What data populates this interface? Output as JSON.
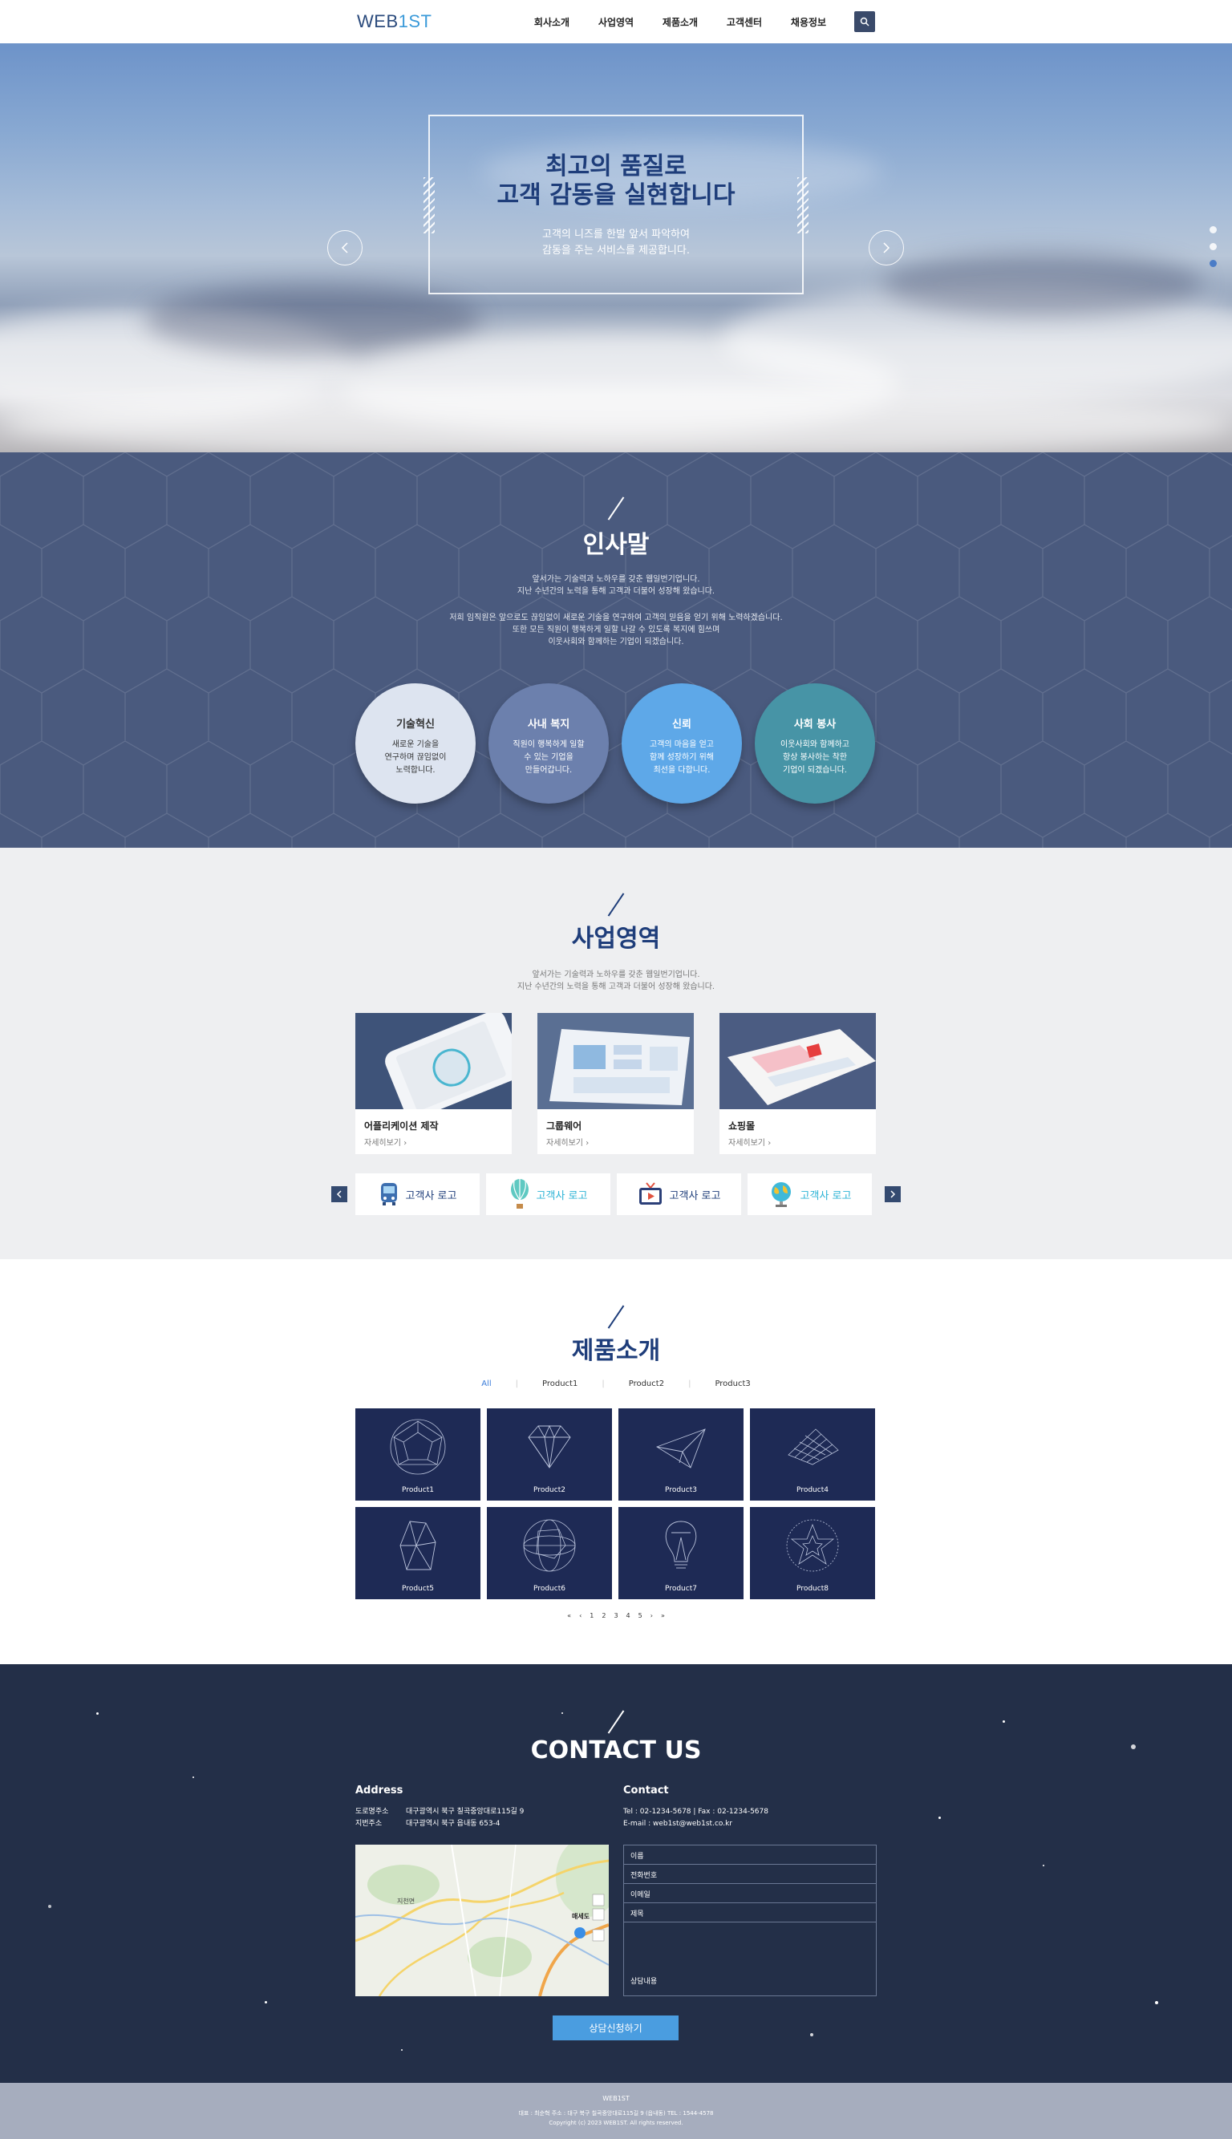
{
  "header": {
    "logo_main": "WEB",
    "logo_accent": "1ST",
    "nav": [
      "회사소개",
      "사업영역",
      "제품소개",
      "고객센터",
      "채용정보"
    ]
  },
  "hero": {
    "title_line1": "최고의 품질로",
    "title_line2": "고객 감동을 실현합니다",
    "sub_line1": "고객의 니즈를 한발 앞서 파악하여",
    "sub_line2": "감동을 주는 서비스를 제공합니다."
  },
  "greeting": {
    "title": "인사말",
    "p1_line1": "앞서가는 기술력과 노하우를 갖춘 웹일번기업니다.",
    "p1_line2": "지난 수년간의 노력을 통해 고객과 더불어 성장해 왔습니다.",
    "p2_line1": "저희 임직원은 앞으로도 끊임없이 새로운 기술을 연구하여 고객의 믿음을 얻기 위해 노력하겠습니다.",
    "p2_line2": "또한 모든 직원이 행복하게 일할 나갈 수 있도록 복지에 힘쓰며",
    "p2_line3": "이웃사회와 함께하는 기업이 되겠습니다.",
    "circles": [
      {
        "title": "기술혁신",
        "l1": "새로운 기술을",
        "l2": "연구하며 끊임없이",
        "l3": "노력합니다.",
        "bg": "#dde4f0",
        "fg": "#333"
      },
      {
        "title": "사내 복지",
        "l1": "직원이 행복하게 일할",
        "l2": "수 있는 기업을",
        "l3": "만들어갑니다.",
        "bg": "#6c80ad",
        "fg": "#fff"
      },
      {
        "title": "신뢰",
        "l1": "고객의 마음을 얻고",
        "l2": "함께 성장하기 위해",
        "l3": "최선을 다합니다.",
        "bg": "#5ea8e8",
        "fg": "#fff"
      },
      {
        "title": "사회 봉사",
        "l1": "이웃사회와 함께하고",
        "l2": "항상 봉사하는 착한",
        "l3": "기업이 되겠습니다.",
        "bg": "#4794a6",
        "fg": "#fff"
      }
    ]
  },
  "business": {
    "title": "사업영역",
    "sub_line1": "앞서가는 기술력과 노하우를 갖춘 웹일번기업니다.",
    "sub_line2": "지난 수년간의 노력을 통해 고객과 더불어 성장해 왔습니다.",
    "cards": [
      {
        "title": "어플리케이션 제작",
        "more": "자세히보기"
      },
      {
        "title": "그룹웨어",
        "more": "자세히보기"
      },
      {
        "title": "쇼핑몰",
        "more": "자세히보기"
      }
    ],
    "client_logos": [
      "고객사 로고",
      "고객사 로고",
      "고객사 로고",
      "고객사 로고"
    ]
  },
  "products": {
    "title": "제품소개",
    "tabs": [
      "All",
      "Product1",
      "Product2",
      "Product3"
    ],
    "items": [
      "Product1",
      "Product2",
      "Product3",
      "Product4",
      "Product5",
      "Product6",
      "Product7",
      "Product8"
    ],
    "pager": [
      "1",
      "2",
      "3",
      "4",
      "5"
    ]
  },
  "contact": {
    "title": "CONTACT US",
    "address_heading": "Address",
    "road_label": "도로명주소",
    "road_value": "대구광역시 북구 칠곡중앙대로115길 9",
    "lot_label": "지번주소",
    "lot_value": "대구광역시 북구 읍내동 653-4",
    "contact_heading": "Contact",
    "tel": "Tel : 02-1234-5678  |  Fax : 02-1234-5678",
    "email": "E-mail : web1st@web1st.co.kr",
    "form_fields": [
      "이름",
      "전화번호",
      "이메일",
      "제목"
    ],
    "message_label": "상담내용",
    "submit": "상담신청하기",
    "map_label1": "지천면",
    "map_label2": "매세도"
  },
  "footer": {
    "name": "WEB1ST",
    "info": "대표 : 최순혁      주소 : 대구 북구 칠곡중앙대로115길 9 (읍내동)      TEL : 1544-4578",
    "copyright": "Copyright (c) 2023 WEB1ST. All rights reserved."
  }
}
